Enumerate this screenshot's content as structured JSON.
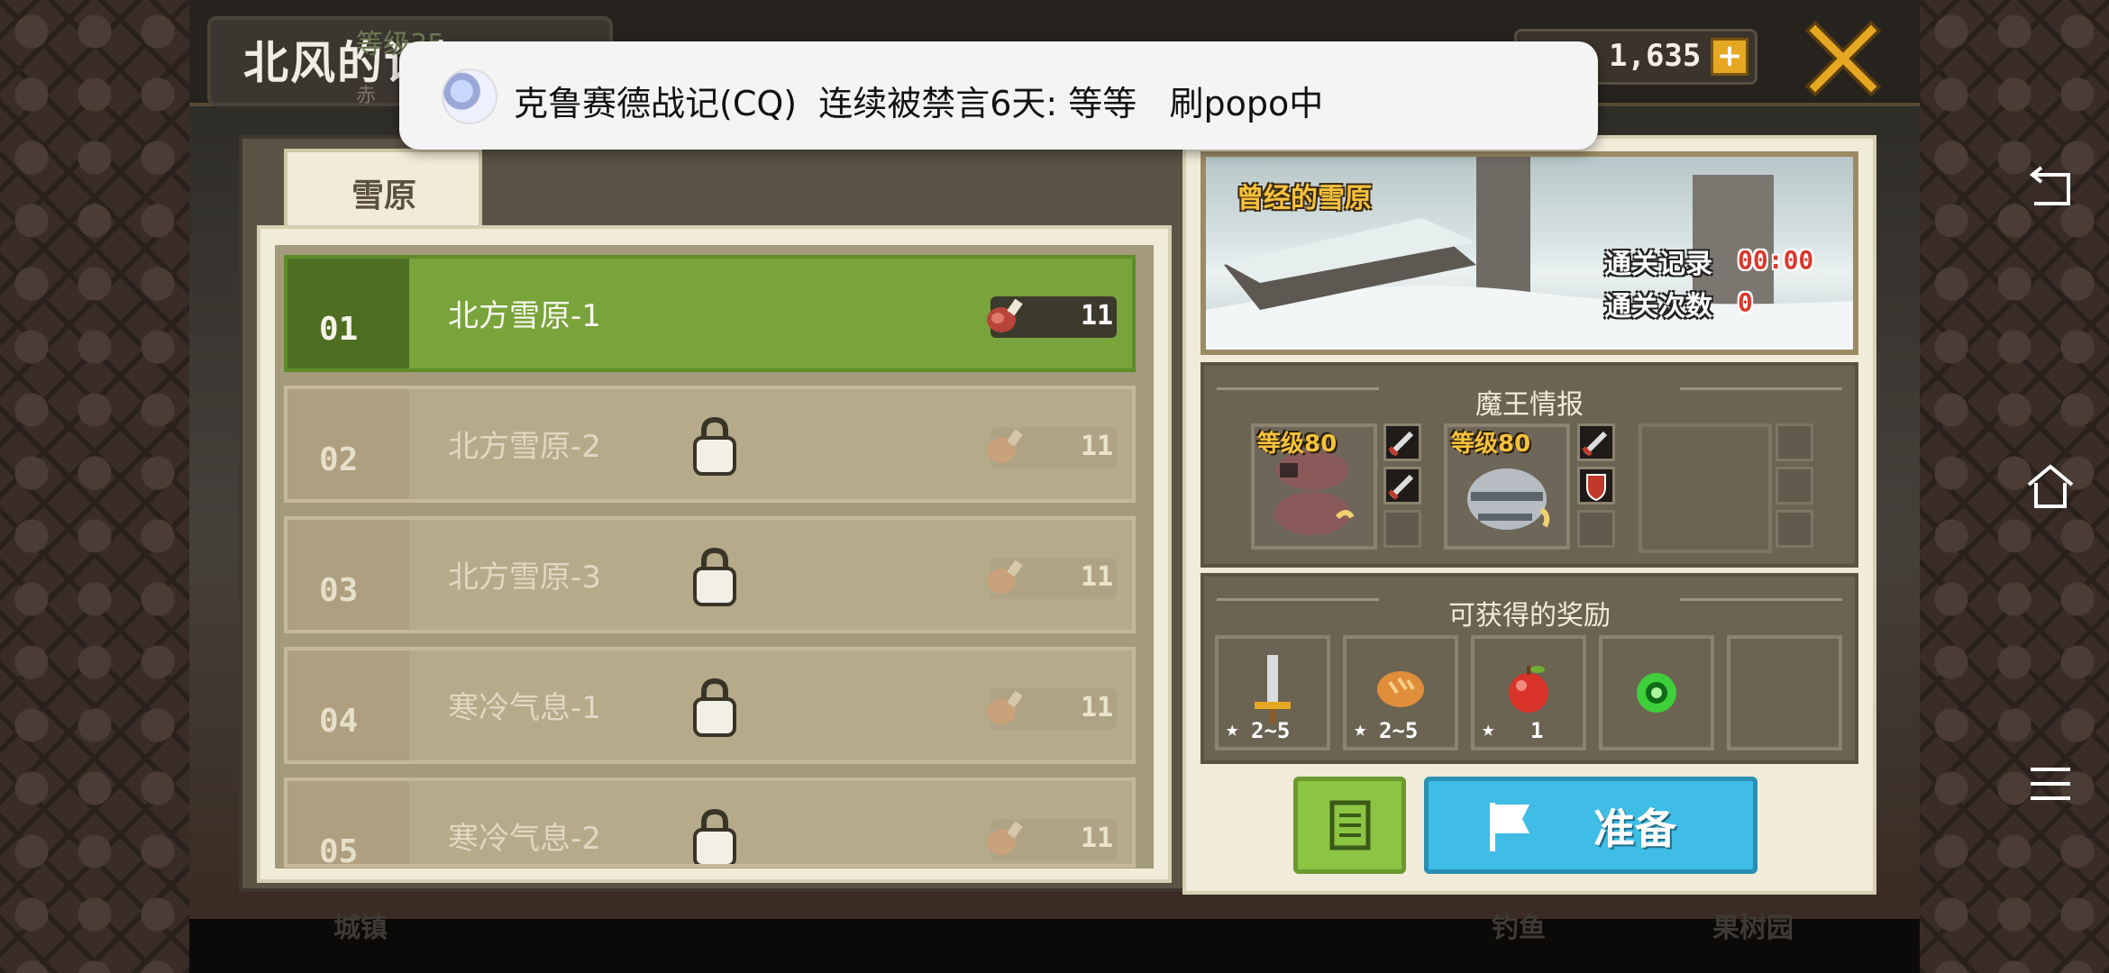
{
  "window": {
    "title": "北风的记忆",
    "title_sub": "赤",
    "faded_behind_toast": "等级35"
  },
  "currency": {
    "amount": "1,635",
    "add_label": "+"
  },
  "notification": {
    "app": "克鲁赛德战记(CQ)",
    "message": "克鲁赛德战记(CQ)  连续被禁言6天: 等等   刷popo中"
  },
  "tabs": [
    {
      "label": "雪原",
      "selected": true
    }
  ],
  "stages": [
    {
      "num": "01",
      "name": "北方雪原-1",
      "cost": "11",
      "locked": false,
      "selected": true
    },
    {
      "num": "02",
      "name": "北方雪原-2",
      "cost": "11",
      "locked": true,
      "selected": false
    },
    {
      "num": "03",
      "name": "北方雪原-3",
      "cost": "11",
      "locked": true,
      "selected": false
    },
    {
      "num": "04",
      "name": "寒冷气息-1",
      "cost": "11",
      "locked": true,
      "selected": false
    },
    {
      "num": "05",
      "name": "寒冷气息-2",
      "cost": "11",
      "locked": true,
      "selected": false
    }
  ],
  "detail": {
    "scene_name": "曾经的雪原",
    "clear_record_label": "通关记录",
    "clear_record_value": "00:00",
    "clear_count_label": "通关次数",
    "clear_count_value": "0"
  },
  "boss_info": {
    "title": "魔王情报",
    "bosses": [
      {
        "level": "等级80",
        "icon": "boar-boss-icon",
        "attrs": [
          "sword-icon",
          "sword-icon"
        ]
      },
      {
        "level": "等级80",
        "icon": "armored-boss-icon",
        "attrs": [
          "sword-icon",
          "shield-icon"
        ]
      }
    ]
  },
  "rewards": {
    "title": "可获得的奖励",
    "items": [
      {
        "icon": "sword-icon",
        "qty": "2~5"
      },
      {
        "icon": "bread-icon",
        "qty": "2~5"
      },
      {
        "icon": "apple-icon",
        "qty": "1"
      },
      {
        "icon": "green-orb-icon",
        "qty": ""
      },
      {
        "icon": "",
        "qty": ""
      }
    ]
  },
  "actions": {
    "list_icon": "list-icon",
    "ready_label": "准备"
  },
  "background_labels": {
    "town": "城镇",
    "fishing": "钓鱼",
    "orchard": "果树园"
  },
  "system_nav": [
    "back-icon",
    "home-icon",
    "menu-icon"
  ],
  "colors": {
    "active_stage": "#79a33b",
    "ready_button": "#3fbde6",
    "list_button": "#8cc443",
    "record_value": "#d83a2e",
    "gold": "#f6c23d"
  }
}
